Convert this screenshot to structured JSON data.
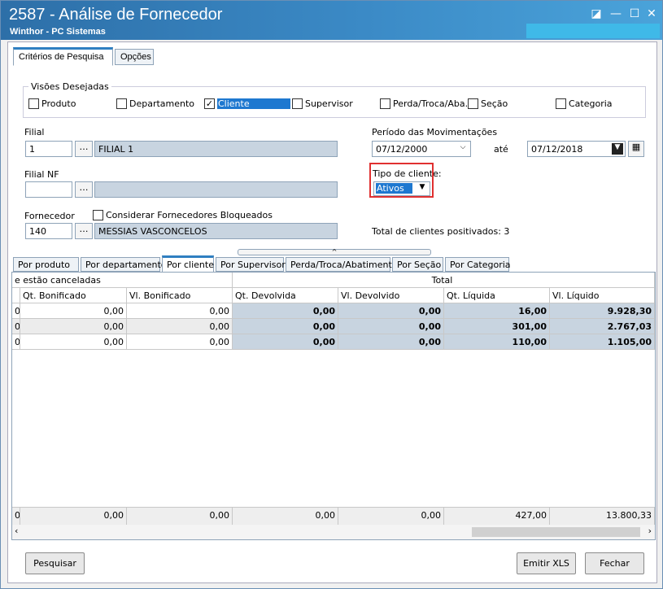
{
  "window": {
    "title": "2587 - Análise de Fornecedor",
    "subtitle": "Winthor - PC Sistemas",
    "controls": [
      "◪",
      "—",
      "☐",
      "✕"
    ]
  },
  "tabs": [
    {
      "label": "Critérios de Pesquisa"
    },
    {
      "label": "Opções"
    }
  ],
  "visoes": {
    "label": "Visões Desejadas",
    "items": [
      {
        "label": "Produto",
        "checked": false
      },
      {
        "label": "Departamento",
        "checked": false
      },
      {
        "label": "Cliente",
        "checked": true
      },
      {
        "label": "Supervisor",
        "checked": false
      },
      {
        "label": "Perda/Troca/Aba.",
        "checked": false
      },
      {
        "label": "Seção",
        "checked": false
      },
      {
        "label": "Categoria",
        "checked": false
      }
    ]
  },
  "filial": {
    "label": "Filial",
    "value": "1",
    "desc": "FILIAL 1"
  },
  "filialnf": {
    "label": "Filial NF",
    "value": "",
    "desc": ""
  },
  "fornecedor": {
    "label": "Fornecedor",
    "value": "140",
    "desc": "MESSIAS VASCONCELOS",
    "chk_label": "Considerar Fornecedores Bloqueados"
  },
  "periodo": {
    "label": "Período das Movimentações",
    "start": "07/12/2000",
    "ate": "até",
    "end": "07/12/2018"
  },
  "tipo_cliente": {
    "label": "Tipo de cliente:",
    "value": "Ativos"
  },
  "total_clientes": "Total de clientes positivados: 3",
  "subtabs": [
    "Por produto",
    "Por departamento",
    "Por cliente",
    "Por Supervisor",
    "Perda/Troca/Abatimento",
    "Por Seção",
    "Por Categoria"
  ],
  "grid": {
    "group_left": "e estão canceladas",
    "group_right": "Total",
    "columns": [
      "Qt. Bonificado",
      "Vl. Bonificado",
      "Qt. Devolvida",
      "Vl. Devolvido",
      "Qt. Líquida",
      "Vl. Líquido"
    ],
    "rows": [
      [
        "0",
        "0,00",
        "0,00",
        "0,00",
        "0,00",
        "16,00",
        "9.928,30"
      ],
      [
        "0",
        "0,00",
        "0,00",
        "0,00",
        "0,00",
        "301,00",
        "2.767,03"
      ],
      [
        "0",
        "0,00",
        "0,00",
        "0,00",
        "0,00",
        "110,00",
        "1.105,00"
      ]
    ],
    "footer": [
      "0",
      "0,00",
      "0,00",
      "0,00",
      "0,00",
      "427,00",
      "13.800,33"
    ]
  },
  "buttons": {
    "pesquisar": "Pesquisar",
    "emitir": "Emitir XLS",
    "fechar": "Fechar"
  }
}
